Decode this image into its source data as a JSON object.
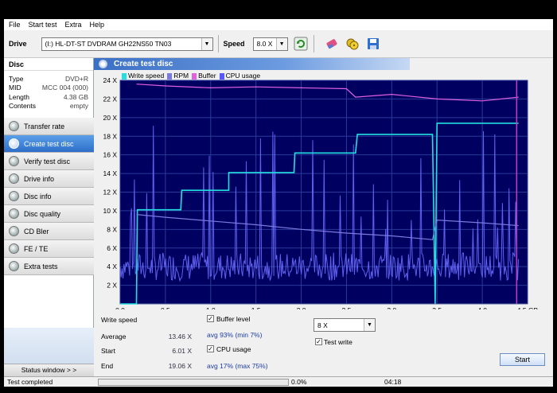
{
  "menu": [
    "File",
    "Start test",
    "Extra",
    "Help"
  ],
  "toolbar": {
    "drive_label": "Drive",
    "drive_value": "(I:)  HL-DT-ST DVDRAM GH22NS50 TN03",
    "speed_label": "Speed",
    "speed_value": "8.0 X",
    "icons": [
      "refresh-icon",
      "eraser-icon",
      "copy-icon",
      "save-icon"
    ]
  },
  "disc": {
    "header": "Disc",
    "rows": [
      {
        "label": "Type",
        "value": "DVD+R"
      },
      {
        "label": "MID",
        "value": "MCC 004 (000)"
      },
      {
        "label": "Length",
        "value": "4.38 GB"
      },
      {
        "label": "Contents",
        "value": "empty"
      }
    ]
  },
  "nav": [
    {
      "label": "Transfer rate",
      "active": false
    },
    {
      "label": "Create test disc",
      "active": true
    },
    {
      "label": "Verify test disc",
      "active": false
    },
    {
      "label": "Drive info",
      "active": false
    },
    {
      "label": "Disc info",
      "active": false
    },
    {
      "label": "Disc quality",
      "active": false
    },
    {
      "label": "CD Bler",
      "active": false
    },
    {
      "label": "FE / TE",
      "active": false
    },
    {
      "label": "Extra tests",
      "active": false
    }
  ],
  "status_window_label": "Status window > >",
  "panel_title": "Create test disc",
  "chart_data": {
    "type": "line",
    "legend": [
      {
        "name": "Write speed",
        "color": "#22e0e0"
      },
      {
        "name": "RPM",
        "color": "#7a7ae0"
      },
      {
        "name": "Buffer",
        "color": "#e060e0"
      },
      {
        "name": "CPU usage",
        "color": "#5858ff"
      }
    ],
    "x_ticks": [
      "0.0",
      "0.5",
      "1.0",
      "1.5",
      "2.0",
      "2.5",
      "3.0",
      "3.5",
      "4.0",
      "4.5 GB"
    ],
    "y_ticks": [
      "2 X",
      "4 X",
      "6 X",
      "8 X",
      "10 X",
      "12 X",
      "14 X",
      "16 X",
      "18 X",
      "20 X",
      "22 X",
      "24 X"
    ],
    "xlim": [
      0,
      4.5
    ],
    "ylim": [
      0,
      24
    ],
    "background": "#000060",
    "grid": true,
    "series": [
      {
        "name": "Write speed",
        "x": [
          0,
          0.18,
          0.19,
          0.5,
          0.6,
          0.67,
          0.68,
          0.98,
          1.18,
          1.2,
          1.2,
          1.45,
          1.9,
          1.92,
          1.93,
          2.2,
          2.5,
          2.6,
          2.62,
          2.7,
          3.2,
          3.45,
          3.48,
          3.5,
          4.0,
          4.4
        ],
        "y": [
          0,
          0,
          10.1,
          10.1,
          10.1,
          10.1,
          12.2,
          12.2,
          12.2,
          12.2,
          14.1,
          14.1,
          14.1,
          14.1,
          16.2,
          16.2,
          16.2,
          16.2,
          18.2,
          18.2,
          18.2,
          18.2,
          0,
          19.4,
          19.4,
          19.4
        ]
      },
      {
        "name": "RPM",
        "x": [
          0.18,
          0.5,
          1.0,
          1.5,
          2.0,
          2.5,
          3.0,
          3.45,
          3.5,
          4.0,
          4.4
        ],
        "y": [
          9.6,
          9.3,
          8.9,
          8.5,
          8.0,
          7.6,
          7.3,
          6.9,
          9.0,
          8.7,
          8.4
        ]
      },
      {
        "name": "Buffer",
        "x": [
          0.18,
          0.5,
          1.0,
          1.5,
          2.0,
          2.5,
          2.6,
          3.0,
          3.5,
          4.0,
          4.4
        ],
        "y": [
          23.6,
          23.4,
          23.2,
          23.3,
          23.2,
          23.1,
          22.2,
          22.5,
          22.0,
          21.8,
          22.2
        ]
      }
    ]
  },
  "stats": {
    "title": "Write speed",
    "average_label": "Average",
    "average_value": "13.46 X",
    "start_label": "Start",
    "start_value": "6.01 X",
    "end_label": "End",
    "end_value": "19.06 X"
  },
  "options": {
    "buffer_label": "Buffer level",
    "buffer_checked": true,
    "buffer_stat": "avg 93% (min 7%)",
    "cpu_label": "CPU usage",
    "cpu_checked": true,
    "cpu_stat": "avg 17% (max 75%)",
    "speed_select": "8 X",
    "testwrite_label": "Test write",
    "testwrite_checked": true,
    "start_button": "Start"
  },
  "status": {
    "text": "Test completed",
    "progress_percent": "0.0%",
    "progress": 0,
    "time": "04:18"
  }
}
